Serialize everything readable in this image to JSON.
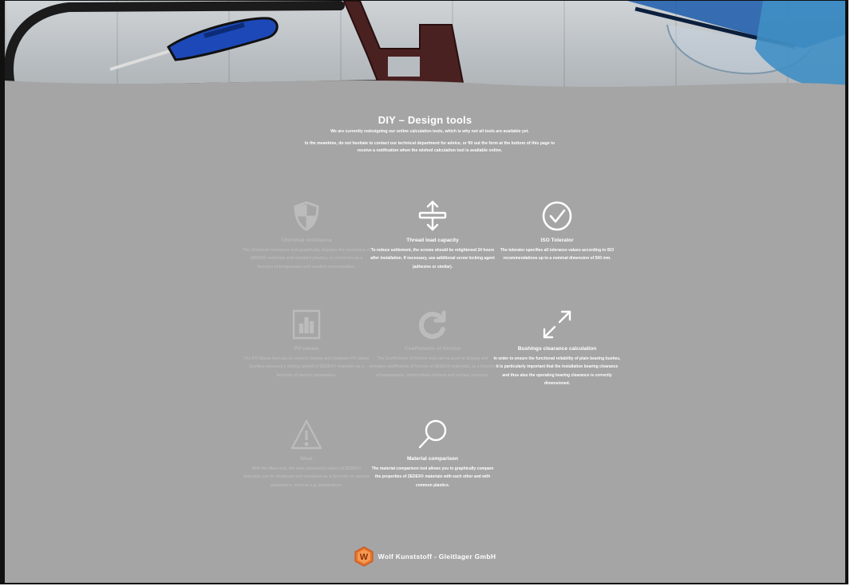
{
  "page": {
    "title": "DIY – Design tools",
    "intro_1": "We are currently redesigning our online calculation tools, which is why not all tools are available yet.",
    "intro_2": "In the meantime, do not hesitate to contact our technical department for advice, or fill out the form at the bottom of this page to receive a notification when the wished calculation tool is available online."
  },
  "tools": [
    {
      "title": "Chemical resistance",
      "desc": "The Chemical resistance tool graphically displays the resistance of ZEDEX® materials and standard plastics, to chemicals as a function of temperature and solution concentration.",
      "icon": "shield-icon",
      "available": false
    },
    {
      "title": "Thread load capacity",
      "desc": "To reduce settlement, the screws should be retightened 24 hours after installation. If necessary, use additional screw locking agent (adhesive or similar).",
      "icon": "thread-load-icon",
      "available": true
    },
    {
      "title": "ISO Tolerator",
      "desc": "The tolerator specifies all tolerance values according to ISO recommendations up to a nominal dimension of 500 mm.",
      "icon": "check-circle-icon",
      "available": true
    },
    {
      "title": "PV-values",
      "desc": "The PV-Values tool can be used to display and compare PV values (surface pressure x sliding speed) of ZEDEX® materials as a function of various parameters.",
      "icon": "bar-chart-icon",
      "available": false
    },
    {
      "title": "Coefficients of friction",
      "desc": "The Coefficients of friction tool can be used to display and compare coefficients of friction of ZEDEX® materials, as a function of temperature, intermediate medium and surface pressure.",
      "icon": "refresh-icon",
      "available": false
    },
    {
      "title": "Bushings clearance calculation",
      "desc": "In order to ensure the functional reliability of plain bearing bushes, it is particularly important that the installation bearing clearance and thus also the operating bearing clearance is correctly dimensioned.",
      "icon": "expand-arrows-icon",
      "available": true
    },
    {
      "title": "Wear",
      "desc": "With the Wear tool, the wear (abrasion) values of ZEDEX® materials can be displayed and compared as a function on various parameters, such as e.g. temperature.",
      "icon": "warning-icon",
      "available": false
    },
    {
      "title": "Material comparison",
      "desc": "The material comparison tool allows you to graphically compare the properties of ZEDEX® materials with each other and with common plastics.",
      "icon": "search-icon",
      "available": true
    }
  ],
  "footer": {
    "company": "Wolf Kunststoff - Gleitlager GmbH",
    "logo_letter": "W"
  },
  "colors": {
    "background": "#a5a5a5",
    "active_text": "#ffffff",
    "inactive_text": "#b9b9b9",
    "logo_orange": "#e8702a"
  }
}
